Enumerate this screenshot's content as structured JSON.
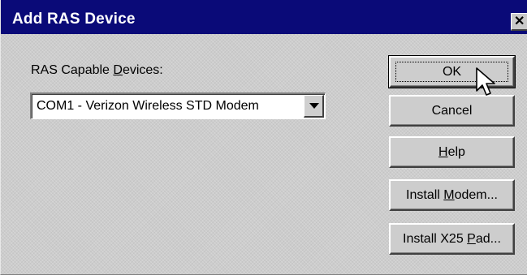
{
  "window": {
    "title": "Add RAS Device",
    "close_label": "×"
  },
  "devices": {
    "label": "RAS Capable Devices:",
    "label_mnemonic": "D",
    "selected_value": "COM1 - Verizon Wireless STD Modem"
  },
  "buttons": {
    "ok": "OK",
    "cancel": "Cancel",
    "help": "Help",
    "install_modem": "Install Modem...",
    "install_x25": "Install X25 Pad..."
  },
  "icons": {
    "close": "close-icon",
    "dropdown": "chevron-down-icon",
    "cursor": "mouse-pointer-icon"
  },
  "colors": {
    "titlebar": "#0a0a78",
    "face": "#cdcdcd"
  }
}
